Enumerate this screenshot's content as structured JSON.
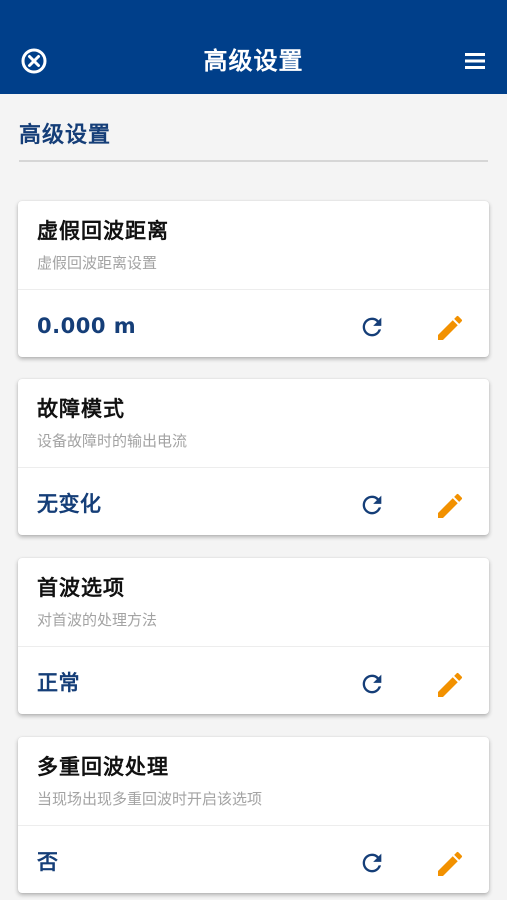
{
  "header": {
    "title": "高级设置",
    "close_icon": "close-circle-icon",
    "menu_icon": "hamburger-menu-icon",
    "background_color": "#003f8a"
  },
  "section": {
    "title": "高级设置"
  },
  "cards": [
    {
      "title": "虚假回波距离",
      "description": "虚假回波距离设置",
      "value": "0.000 m"
    },
    {
      "title": "故障模式",
      "description": "设备故障时的输出电流",
      "value": "无变化"
    },
    {
      "title": "首波选项",
      "description": "对首波的处理方法",
      "value": "正常"
    },
    {
      "title": "多重回波处理",
      "description": "当现场出现多重回波时开启该选项",
      "value": "否"
    }
  ],
  "icons": {
    "reset": "refresh-icon",
    "edit": "pencil-icon"
  },
  "colors": {
    "accent_blue": "#153e78",
    "edit_orange": "#f29100"
  }
}
